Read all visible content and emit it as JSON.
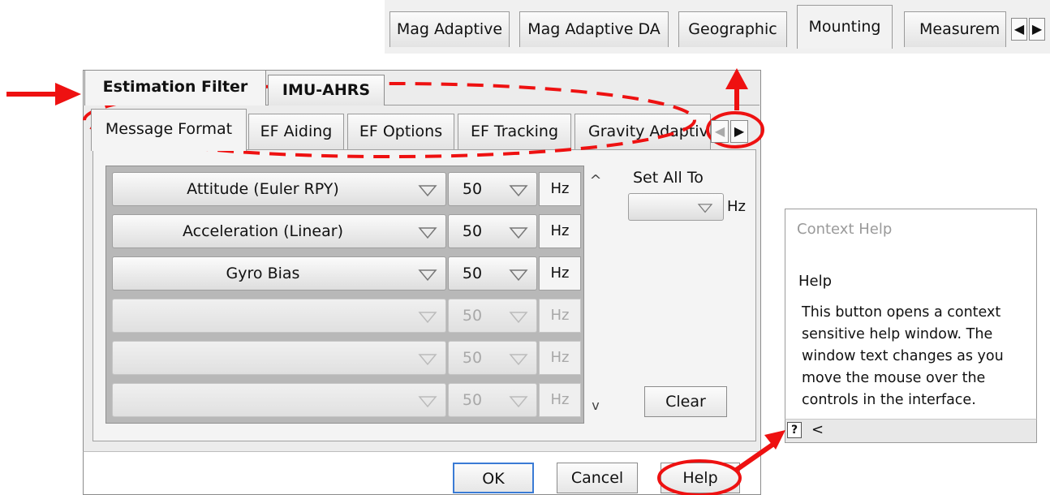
{
  "top_tabs": {
    "tabs": [
      {
        "label": "Mag Adaptive",
        "active": false
      },
      {
        "label": "Mag Adaptive DA",
        "active": false
      },
      {
        "label": "Geographic",
        "active": false
      },
      {
        "label": "Mounting",
        "active": true
      },
      {
        "label": "Measurem",
        "active": false
      }
    ],
    "scroll_left": "◀",
    "scroll_right": "▶"
  },
  "dialog": {
    "outer_tabs": [
      {
        "label": "Estimation Filter",
        "active": true
      },
      {
        "label": "IMU-AHRS",
        "active": false
      }
    ],
    "inner_tabs": [
      {
        "label": "Message Format",
        "active": true
      },
      {
        "label": "EF Aiding",
        "active": false
      },
      {
        "label": "EF Options",
        "active": false
      },
      {
        "label": "EF Tracking",
        "active": false
      },
      {
        "label": "Gravity Adaptiv",
        "active": false
      }
    ],
    "inner_scroll_left": "◀",
    "inner_scroll_right": "▶",
    "message_rows": [
      {
        "message": "Attitude (Euler RPY)",
        "rate": "50",
        "unit": "Hz",
        "enabled": true
      },
      {
        "message": "Acceleration (Linear)",
        "rate": "50",
        "unit": "Hz",
        "enabled": true
      },
      {
        "message": "Gyro Bias",
        "rate": "50",
        "unit": "Hz",
        "enabled": true
      },
      {
        "message": "",
        "rate": "50",
        "unit": "Hz",
        "enabled": false
      },
      {
        "message": "",
        "rate": "50",
        "unit": "Hz",
        "enabled": false
      },
      {
        "message": "",
        "rate": "50",
        "unit": "Hz",
        "enabled": false
      }
    ],
    "scroll_up": "^",
    "scroll_down": "v",
    "set_all_to": {
      "label": "Set All To",
      "value": "",
      "unit": "Hz"
    },
    "clear_label": "Clear",
    "ok_label": "OK",
    "cancel_label": "Cancel",
    "help_label": "Help"
  },
  "context_help": {
    "title": "Context Help",
    "heading": "Help",
    "body_lines": [
      "This button opens a context",
      "sensitive help window.  The",
      "window text changes as you",
      "move the mouse over the",
      "controls in the interface."
    ],
    "question_icon": "?",
    "collapse_icon": "<"
  },
  "colors": {
    "annotation": "#ee1111",
    "dialog_bg": "#ececec",
    "list_bg": "#b8b8b8"
  }
}
